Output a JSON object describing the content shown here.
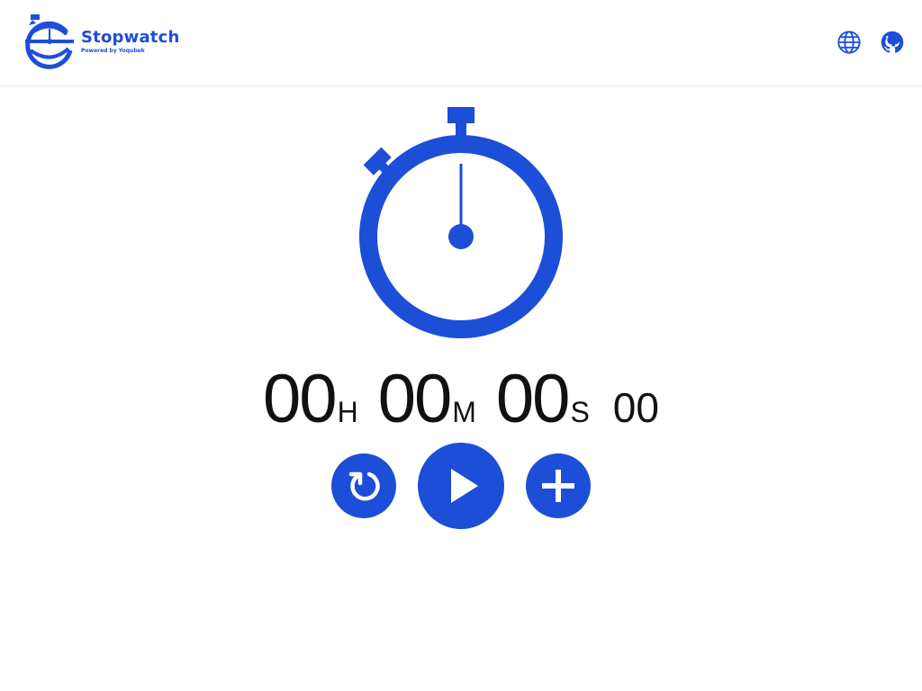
{
  "header": {
    "brand_name": "Stopwatch",
    "brand_tagline": "Powered by Yoqubek",
    "icons": [
      "language-globe-icon",
      "github-icon"
    ]
  },
  "timer": {
    "hours": "00",
    "hours_unit": "H",
    "minutes": "00",
    "minutes_unit": "M",
    "seconds": "00",
    "seconds_unit": "S",
    "centiseconds": "00"
  },
  "controls": {
    "icons": [
      "reset-icon",
      "play-icon",
      "plus-icon"
    ]
  },
  "colors": {
    "accent": "#1d4ed8",
    "text": "#111111",
    "background": "#ffffff"
  }
}
